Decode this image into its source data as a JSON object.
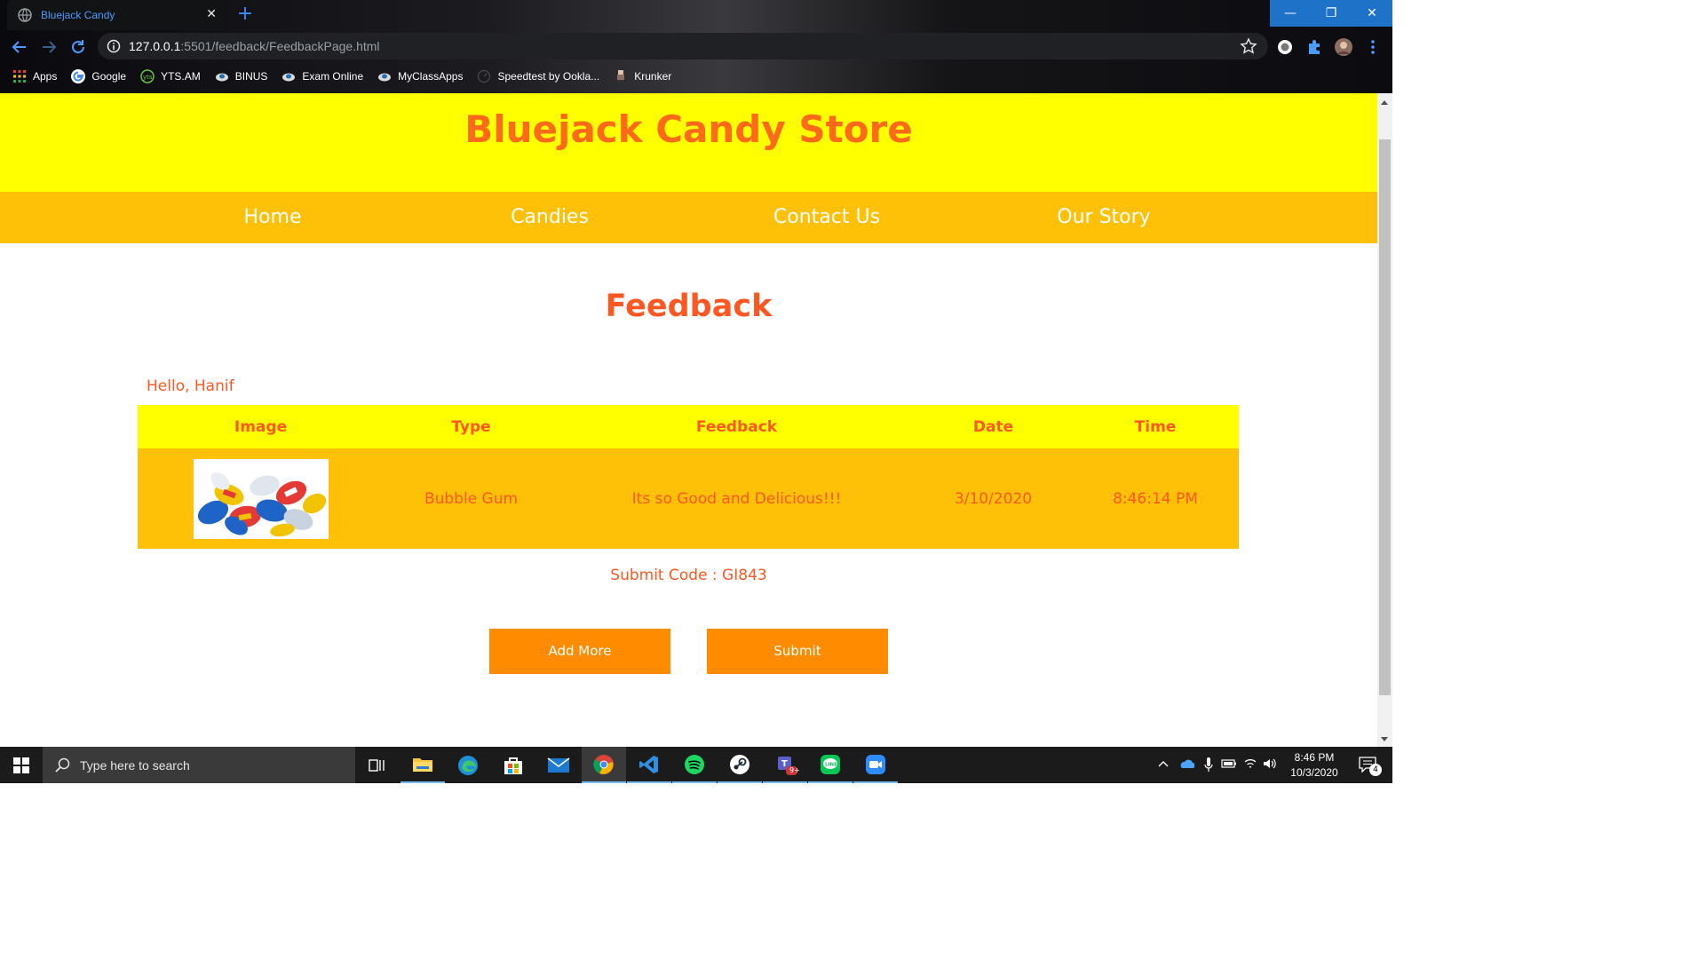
{
  "browser": {
    "tab_title": "Bluejack Candy",
    "url_host": "127.0.0.1",
    "url_path": ":5501/feedback/FeedbackPage.html",
    "bookmarks": [
      {
        "label": "Apps",
        "icon": "apps-grid-icon"
      },
      {
        "label": "Google",
        "icon": "google-icon"
      },
      {
        "label": "YTS.AM",
        "icon": "yts-icon"
      },
      {
        "label": "BINUS",
        "icon": "binus-icon"
      },
      {
        "label": "Exam Online",
        "icon": "binus-icon"
      },
      {
        "label": "MyClassApps",
        "icon": "binus-icon"
      },
      {
        "label": "Speedtest by Ookla...",
        "icon": "speedtest-icon"
      },
      {
        "label": "Krunker",
        "icon": "krunker-icon"
      }
    ]
  },
  "site": {
    "title": "Bluejack Candy Store",
    "nav": [
      "Home",
      "Candies",
      "Contact Us",
      "Our Story"
    ],
    "colors": {
      "header_bg": "#ffff00",
      "nav_bg": "#ffc107",
      "accent": "#ff5722",
      "button_bg": "#ff8c00"
    }
  },
  "page": {
    "heading": "Feedback",
    "greeting": "Hello, Hanif",
    "table": {
      "headers": [
        "Image",
        "Type",
        "Feedback",
        "Date",
        "Time"
      ],
      "rows": [
        {
          "image": "bubble-gum-candies-photo",
          "type": "Bubble Gum",
          "feedback": "Its so Good and Delicious!!!",
          "date": "3/10/2020",
          "time": "8:46:14 PM"
        }
      ]
    },
    "submit_code": "Submit Code : GI843",
    "buttons": {
      "add_more": "Add More",
      "submit": "Submit"
    }
  },
  "taskbar": {
    "search_placeholder": "Type here to search",
    "apps": [
      "task-view",
      "file-explorer",
      "edge",
      "store",
      "mail",
      "chrome",
      "vscode",
      "spotify",
      "steam",
      "teams",
      "line",
      "zoom"
    ],
    "teams_badge": "9+",
    "clock_time": "8:46 PM",
    "clock_date": "10/3/2020",
    "notification_count": "4"
  }
}
